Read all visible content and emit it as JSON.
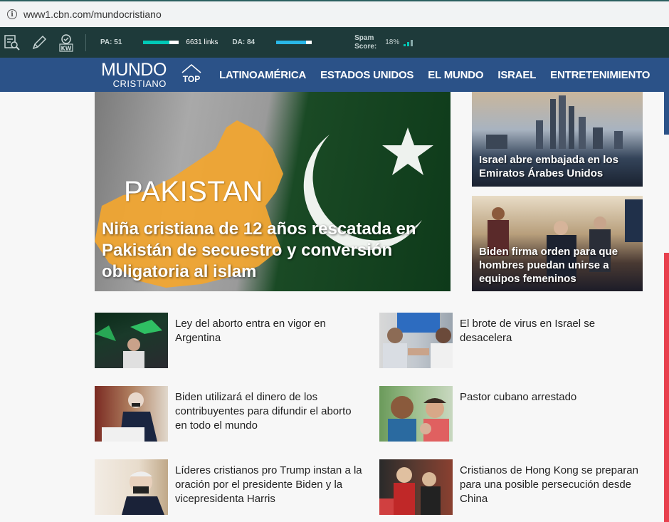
{
  "browser": {
    "url": "www1.cbn.com/mundocristiano"
  },
  "seobar": {
    "pa_label": "PA: 51",
    "pa_fraction": 0.74,
    "links": "6631 links",
    "da_label": "DA: 84",
    "da_fraction": 0.84,
    "spam_label_1": "Spam",
    "spam_label_2": "Score:",
    "spam_value": "18%",
    "colors": {
      "teal": "#00c9b7",
      "blue": "#2ab7e8"
    }
  },
  "nav": {
    "logo_line1": "MUNDO",
    "logo_line2": "CRISTIANO",
    "top_label": "TOP",
    "items": [
      "LATINOAMÉRICA",
      "ESTADOS UNIDOS",
      "EL MUNDO",
      "ISRAEL",
      "ENTRETENIMIENTO"
    ],
    "color": "#2b5288"
  },
  "hero": {
    "image_text": "PAKISTAN",
    "title": "Niña cristiana de 12 años rescatada en Pakistán de secuestro y conversión obligatoria al islam"
  },
  "side_stories": [
    {
      "title": "Israel abre embajada en los Emiratos Árabes Unidos"
    },
    {
      "title": "Biden firma orden para que hombres puedan unirse a equipos femeninos"
    }
  ],
  "stories": [
    {
      "title": "Ley del aborto entra en vigor en Argentina"
    },
    {
      "title": "El brote de virus en Israel se desacelera"
    },
    {
      "title": "Biden utilizará el dinero de los contribuyentes para difundir el aborto en todo el mundo"
    },
    {
      "title": "Pastor cubano arrestado"
    },
    {
      "title": "Líderes cristianos pro Trump instan a la oración por el presidente Biden y la vicepresidenta Harris"
    },
    {
      "title": "Cristianos de Hong Kong se preparan para una posible persecución desde China"
    }
  ]
}
